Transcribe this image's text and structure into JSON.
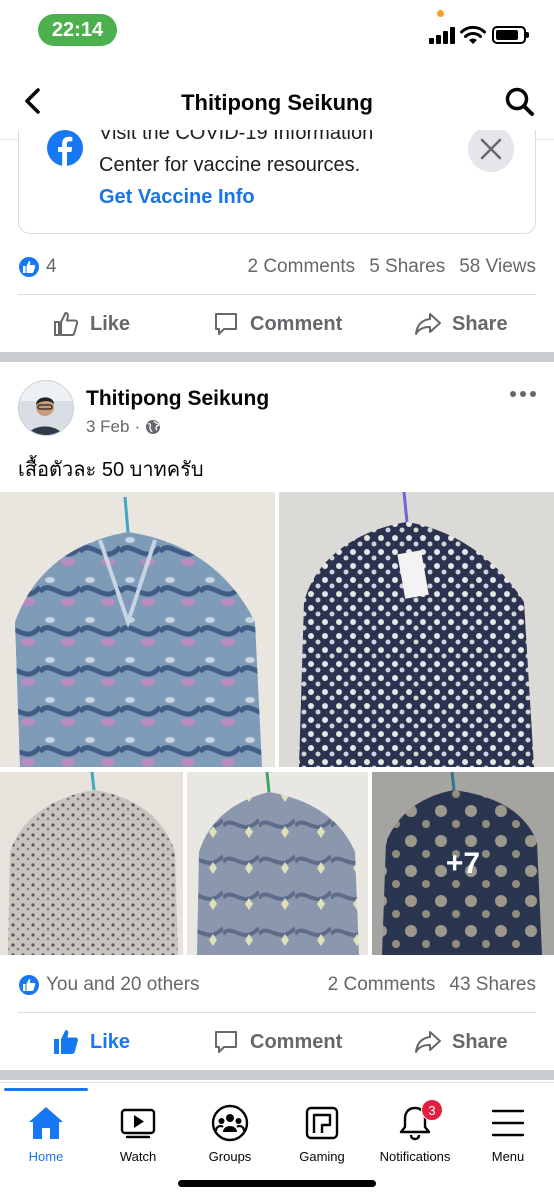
{
  "status_bar": {
    "time": "22:14"
  },
  "header": {
    "title": "Thitipong Seikung"
  },
  "vaccine_card": {
    "line1_cut": "Visit the COVID-19 Information",
    "line2": "Center for vaccine resources.",
    "link": "Get Vaccine Info"
  },
  "prev_post": {
    "reactions": "4",
    "comments": "2 Comments",
    "shares": "5 Shares",
    "views": "58 Views"
  },
  "actions": {
    "like": "Like",
    "comment": "Comment",
    "share": "Share"
  },
  "post": {
    "author": "Thitipong Seikung",
    "date": "3 Feb",
    "text": "เสื้อตัวละ 50 บาทครับ",
    "more_photos": "+7",
    "reactions": "You and 20 others",
    "comments": "2 Comments",
    "shares": "43 Shares"
  },
  "tabs": [
    {
      "label": "Home",
      "icon": "home-icon"
    },
    {
      "label": "Watch",
      "icon": "watch-icon"
    },
    {
      "label": "Groups",
      "icon": "groups-icon"
    },
    {
      "label": "Gaming",
      "icon": "gaming-icon"
    },
    {
      "label": "Notifications",
      "icon": "bell-icon",
      "badge": "3"
    },
    {
      "label": "Menu",
      "icon": "menu-icon"
    }
  ],
  "colors": {
    "brand": "#1877f2",
    "badge": "#e41e3f",
    "status_pill": "#4cb04f"
  }
}
